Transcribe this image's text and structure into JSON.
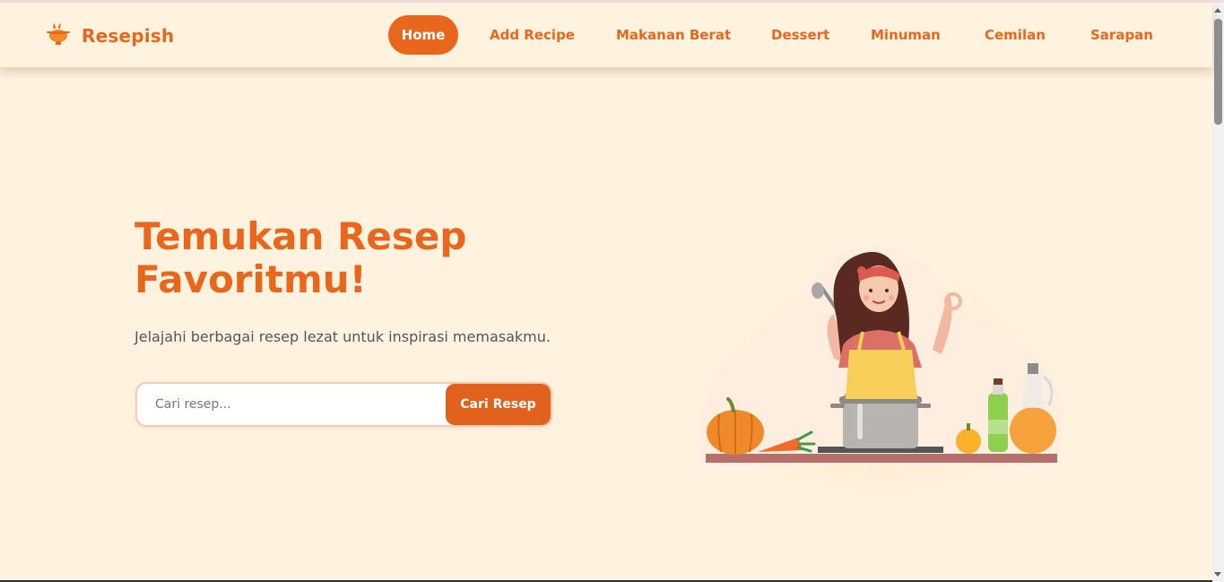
{
  "brand": {
    "name": "Resepish",
    "icon": "cooking-pot-icon"
  },
  "nav": {
    "items": [
      {
        "label": "Home",
        "active": true
      },
      {
        "label": "Add Recipe",
        "active": false
      },
      {
        "label": "Makanan Berat",
        "active": false
      },
      {
        "label": "Dessert",
        "active": false
      },
      {
        "label": "Minuman",
        "active": false
      },
      {
        "label": "Cemilan",
        "active": false
      },
      {
        "label": "Sarapan",
        "active": false
      }
    ]
  },
  "hero": {
    "title": "Temukan Resep Favoritmu!",
    "subtitle": "Jelajahi berbagai resep lezat untuk inspirasi memasakmu.",
    "search": {
      "placeholder": "Cari resep...",
      "value": "",
      "button_label": "Cari Resep"
    }
  },
  "illustration": {
    "name": "woman-cooking-illustration"
  },
  "colors": {
    "accent": "#e8671c",
    "background": "#fff3e0",
    "text_muted": "#555555"
  }
}
